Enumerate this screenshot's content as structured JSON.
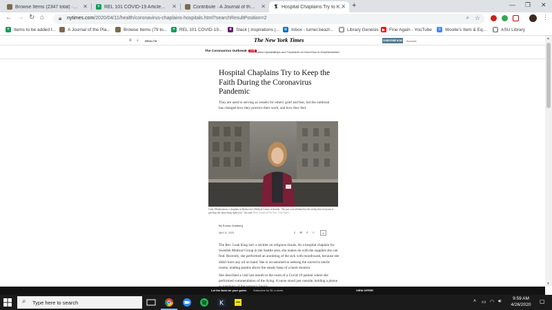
{
  "browser": {
    "tabs": [
      {
        "title": "Browse Items (2347 total) · A Jou",
        "icon": "omeka-icon",
        "active": false
      },
      {
        "title": "REL 101 COVID-19 Articles - Goo",
        "icon": "sheets-icon",
        "active": false
      },
      {
        "title": "Contribute · A Journal of the Pla",
        "icon": "omeka-icon",
        "active": false
      },
      {
        "title": "Hospital Chaplains Try to Keep th",
        "icon": "nyt-icon",
        "active": true
      }
    ],
    "new_tab_label": "+",
    "url_host": "nytimes.com",
    "url_path": "/2020/04/11/health/coronavirus-chaplains-hospitals.html?searchResultPosition=2",
    "bookmarks": [
      {
        "label": "Items to be added t...",
        "icon": "sheets-icon"
      },
      {
        "label": "A Journal of the Pla...",
        "icon": "omeka-icon"
      },
      {
        "label": "Browse Items (79 to...",
        "icon": "omeka-icon"
      },
      {
        "label": "REL 101 COVID-19...",
        "icon": "sheets-icon"
      },
      {
        "label": "Slack | inspirations |...",
        "icon": "slack-icon"
      },
      {
        "label": "Inbox - turner.beazl...",
        "icon": "outlook-icon"
      },
      {
        "label": "Library Genesis",
        "icon": "globe-icon"
      },
      {
        "label": "Fine Again - YouTube",
        "icon": "youtube-icon"
      },
      {
        "label": "Woolie's Item & Eq...",
        "icon": "doc-icon"
      },
      {
        "label": "ASU Library",
        "icon": "globe-icon"
      }
    ]
  },
  "nyt": {
    "masthead_section": "HEALTH",
    "logo": "The New York Times",
    "subscribe_label": "SUBSCRIBE NOW",
    "account_label": "Account",
    "section_nav": {
      "title": "The Coronavirus Outbreak",
      "live_label": "LIVE",
      "items": [
        "Latest Updates",
        "Maps and Tracker",
        "Life at Home",
        "How to Help",
        "Newsletter"
      ]
    },
    "headline": "Hospital Chaplains Try to Keep the Faith During the Coronavirus Pandemic",
    "summary": "They are used to serving as vessels for others' grief and fear, but the outbreak has changed how they practice their work, and how they feel.",
    "caption": "Carly Ellenbeaman, a chaplain at Harborview Medical Center in Seattle. “I'm just overwhelmed by the reality that everyone is grieving the same thing right now,” she said.",
    "caption_credit": "Ruth Fremson/The New York Times",
    "byline": "By Emma Goldberg",
    "date": "April 11, 2020",
    "share_icons": [
      "f",
      "✉",
      "↗",
      "☆"
    ],
    "share_count": "4",
    "paragraphs": [
      "The Rev. Leah Klug isn't a stickler on religious rituals. As a hospital chaplain for Swedish Medical Group in the Seattle area, she makes do with the supplies she can find. Recently, she performed an anointing of the sick with mouthwash, because she didn't have any oil on hand. She is accustomed to seeking the sacred in sterile rooms, reading psalms above the steady beep of a heart monitor.",
      "She described a visit last month to the room of a Covid-19 patient where she performed commendation of the dying. A nurse stood just outside, holding a phone so members of the patient's family"
    ],
    "subscribe_bar": {
      "text": "Let the facts be your guide.",
      "offer": "Subscribe for $1 a week.",
      "cta": "VIEW OFFER"
    }
  },
  "taskbar": {
    "search_placeholder": "Type here to search",
    "time": "9:59 AM",
    "date": "4/26/2020"
  },
  "colors": {
    "tab_bar": "#dee1e6",
    "taskbar": "#1b1b1b",
    "nyt_blue": "#567b95",
    "live_red": "#d0021b"
  }
}
